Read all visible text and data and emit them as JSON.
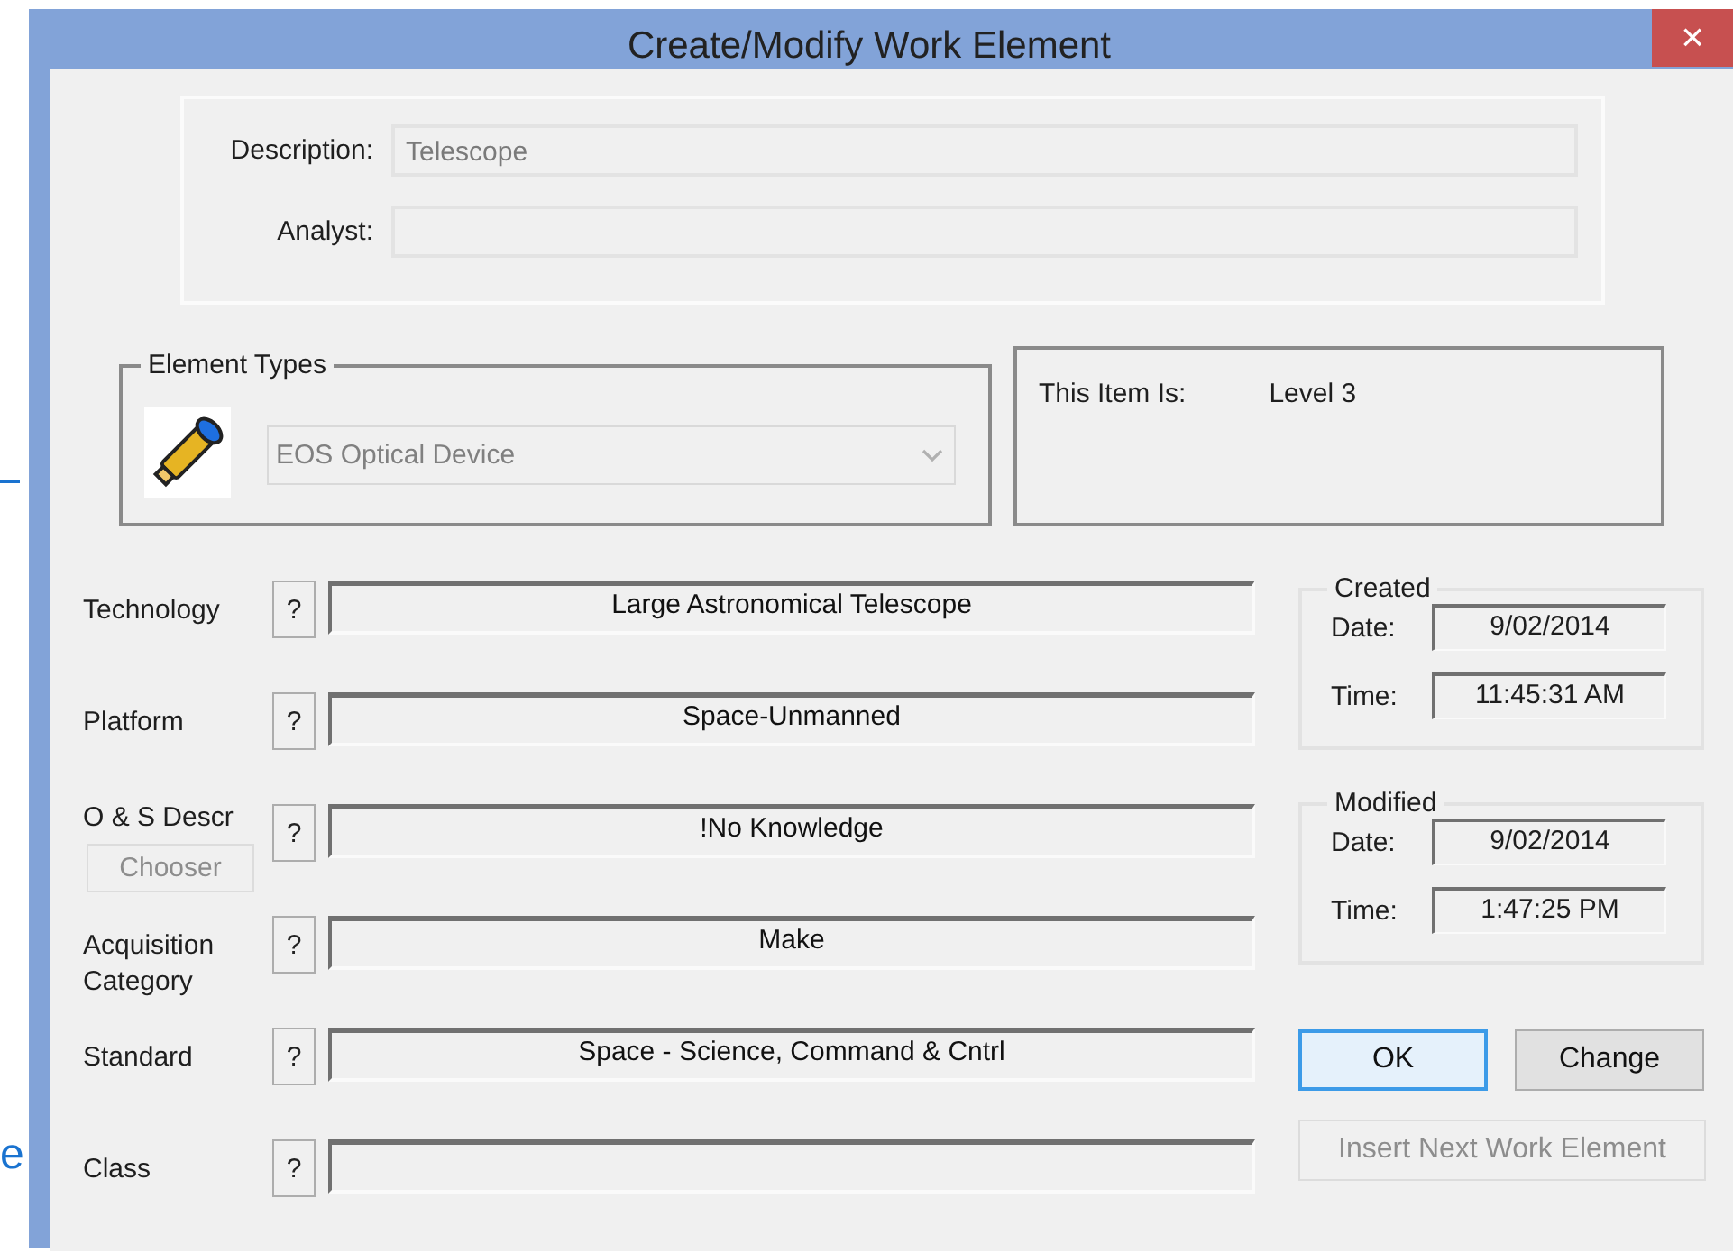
{
  "background": {
    "text_fragment": "e"
  },
  "window": {
    "title": "Create/Modify Work Element",
    "close": "×"
  },
  "general": {
    "fields": [
      {
        "label": "Description:",
        "value": "Telescope"
      },
      {
        "label": "Analyst:"
      }
    ]
  },
  "element_types": {
    "legend": "Element Types",
    "dropdown": {
      "value": "EOS Optical Device",
      "disabled": true
    }
  },
  "item_level": {
    "label": "This Item Is:",
    "value": "Level 3"
  },
  "attributes": [
    {
      "label": "Technology",
      "help": "?",
      "value": "Large Astronomical Telescope"
    },
    {
      "label": "Platform",
      "help": "?",
      "value": "Space-Unmanned"
    },
    {
      "label": "O & S Descr",
      "help": "?",
      "value": "!No Knowledge",
      "chooser": {
        "label": "Chooser",
        "disabled": true
      }
    },
    {
      "label": "Acquisition Category",
      "help": "?",
      "value": "Make"
    },
    {
      "label": "Standard",
      "help": "?",
      "value": "Space - Science, Command & Cntrl"
    },
    {
      "label": "Class",
      "help": "?"
    }
  ],
  "stamps": [
    {
      "legend": "Created",
      "date_label": "Date:",
      "date": "9/02/2014",
      "time_label": "Time:",
      "time": "11:45:31 AM"
    },
    {
      "legend": "Modified",
      "date_label": "Date:",
      "date": "9/02/2014",
      "time_label": "Time:",
      "time": "1:47:25 PM"
    }
  ],
  "buttons": [
    {
      "label": "OK",
      "default": true
    },
    {
      "label": "Change",
      "default": false
    }
  ],
  "insert_button": {
    "label": "Insert Next Work Element",
    "disabled": true
  }
}
